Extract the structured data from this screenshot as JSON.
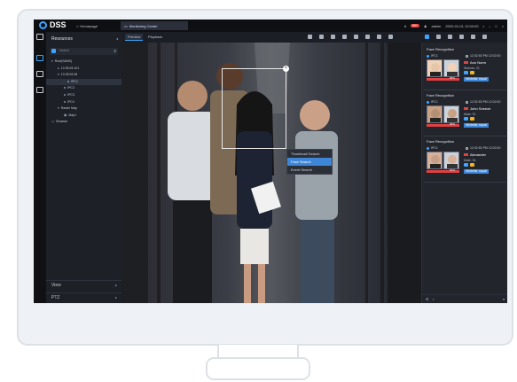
{
  "app": {
    "logo": "DSS",
    "tabs": [
      {
        "label": "Homepage",
        "icon": "home-icon"
      },
      {
        "label": "Monitoring Center",
        "icon": "monitor-icon"
      }
    ],
    "alarm_count": "99+",
    "user": "admin",
    "datetime": "2020-01-01 12:00:00",
    "accent": "#3da5ff"
  },
  "sidebar": {
    "title": "Resources",
    "search_placeholder": "Search",
    "tree": [
      {
        "label": "Root(SANS)",
        "level": 0,
        "glyph": "▾"
      },
      {
        "label": "10.35.94.101",
        "level": 1,
        "glyph": "▸"
      },
      {
        "label": "10.35.94.96",
        "level": 1,
        "glyph": "▾"
      },
      {
        "label": "IPC1",
        "level": 2,
        "glyph": "◘",
        "selected": true
      },
      {
        "label": "IPC2",
        "level": 2,
        "glyph": "◘"
      },
      {
        "label": "IPC3",
        "level": 2,
        "glyph": "◘"
      },
      {
        "label": "IPC4",
        "level": 2,
        "glyph": "◘"
      },
      {
        "label": "Raster Map",
        "level": 1,
        "glyph": "▾"
      },
      {
        "label": "Map1",
        "level": 2,
        "glyph": "▣"
      },
      {
        "label": "Browser",
        "level": 0,
        "glyph": "▭"
      }
    ],
    "bottom": [
      {
        "label": "View"
      },
      {
        "label": "PTZ"
      }
    ]
  },
  "toolbar": {
    "preview": "Preview",
    "playback": "Playback"
  },
  "context_menu": {
    "items": [
      "Thumbnail Search",
      "Face Search",
      "Event Search"
    ],
    "hover_index": 1
  },
  "face_panel": {
    "cards": [
      {
        "title": "Face Recognition",
        "channel": "IPC1",
        "time": "12:02:53 PM 12:02:00",
        "name": "Ann Norm",
        "attr": "Woman: 21",
        "similarity": "88%",
        "tag": "Whitelist: equal"
      },
      {
        "title": "Face Recognition",
        "channel": "IPC1",
        "time": "12:02:53 PM 12:02:00",
        "name": "John Sneeze",
        "attr": "Male: 32",
        "similarity": "98%",
        "tag": "Whitelist: equal"
      },
      {
        "title": "Face Recognition",
        "channel": "IPC1",
        "time": "12:02:53 PM 12:02:00",
        "name": "Alexander",
        "attr": "Male: 34",
        "similarity": "93%",
        "tag": "Whitelist: equal"
      }
    ]
  }
}
